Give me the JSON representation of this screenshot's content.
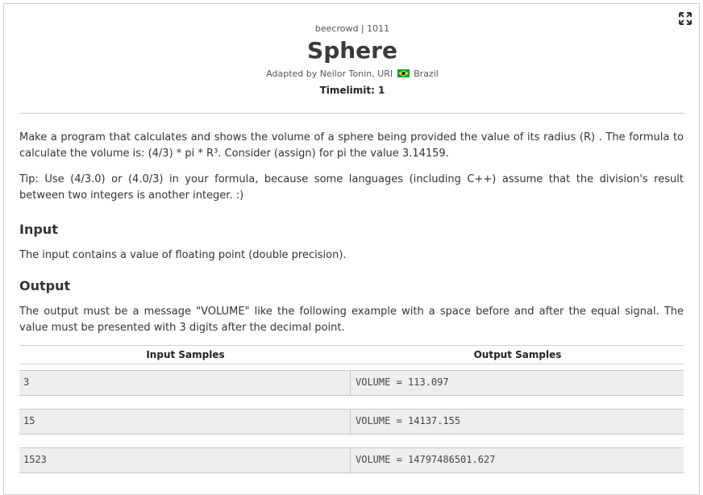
{
  "problem": {
    "source": "beecrowd | 1011",
    "title": "Sphere",
    "adapted_prefix": "Adapted by Neilor Tonin, URI",
    "adapted_suffix": "Brazil",
    "timelimit": "Timelimit: 1"
  },
  "icons": {
    "expand": "expand-icon",
    "flag": "brazil-flag-icon"
  },
  "colors": {
    "text": "#333333",
    "border": "#cfcfcf",
    "sample_bg": "#eeeeee",
    "flag_green": "#009c3b",
    "flag_yellow": "#ffdf00",
    "flag_blue": "#002776"
  },
  "description": {
    "p1": "Make a program that calculates and shows the volume of a sphere being provided the value of its radius (R) . The formula to calculate the volume is: (4/3) * pi * R³. Consider (assign) for pi the value 3.14159.",
    "p2": "Tip: Use (4/3.0) or (4.0/3) in your formula, because some languages (including C++) assume that the division's result between two integers is another integer. :)"
  },
  "input_section": {
    "heading": "Input",
    "text": "The input contains a value of floating point (double precision)."
  },
  "output_section": {
    "heading": "Output",
    "text": "The output must be a message \"VOLUME\" like the following example with a space before and after the equal signal. The value must be presented with 3 digits after the decimal point."
  },
  "samples": {
    "input_header": "Input Samples",
    "output_header": "Output Samples",
    "rows": [
      {
        "input": "3",
        "output": "VOLUME = 113.097"
      },
      {
        "input": "15",
        "output": "VOLUME = 14137.155"
      },
      {
        "input": "1523",
        "output": "VOLUME = 14797486501.627"
      }
    ]
  }
}
